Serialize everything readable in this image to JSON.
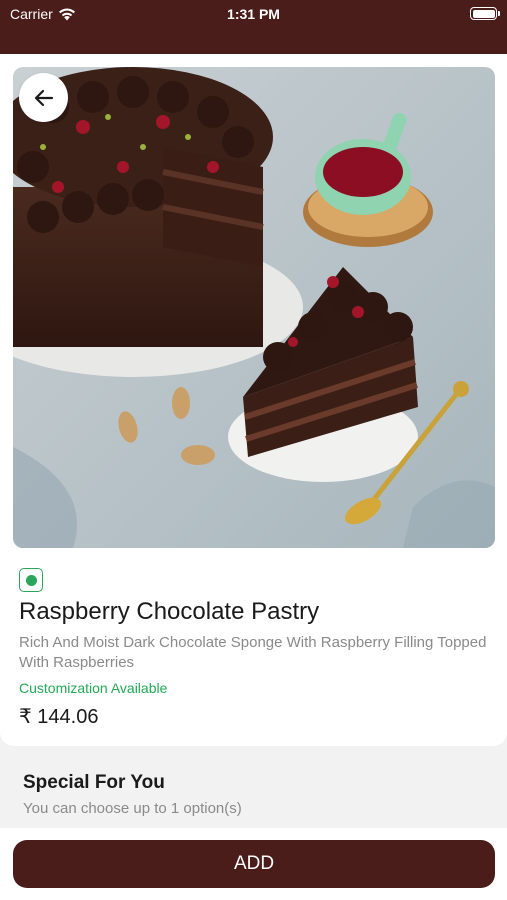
{
  "status_bar": {
    "carrier": "Carrier",
    "time": "1:31 PM"
  },
  "product": {
    "image_icon": "product-photo-raspberry-chocolate-pastry",
    "veg_indicator": "veg-mark-icon",
    "name": "Raspberry Chocolate Pastry",
    "description": "Rich And Moist Dark Chocolate Sponge With Raspberry Filling Topped With Raspberries",
    "customization_note": "Customization Available",
    "price": "₹ 144.06"
  },
  "special_section": {
    "title": "Special For You",
    "subtitle": "You can choose up to 1 option(s)"
  },
  "footer": {
    "add_label": "ADD"
  },
  "colors": {
    "brand": "#4a1c1a",
    "veg_green": "#2aa55a",
    "customization_green": "#22aa55"
  }
}
